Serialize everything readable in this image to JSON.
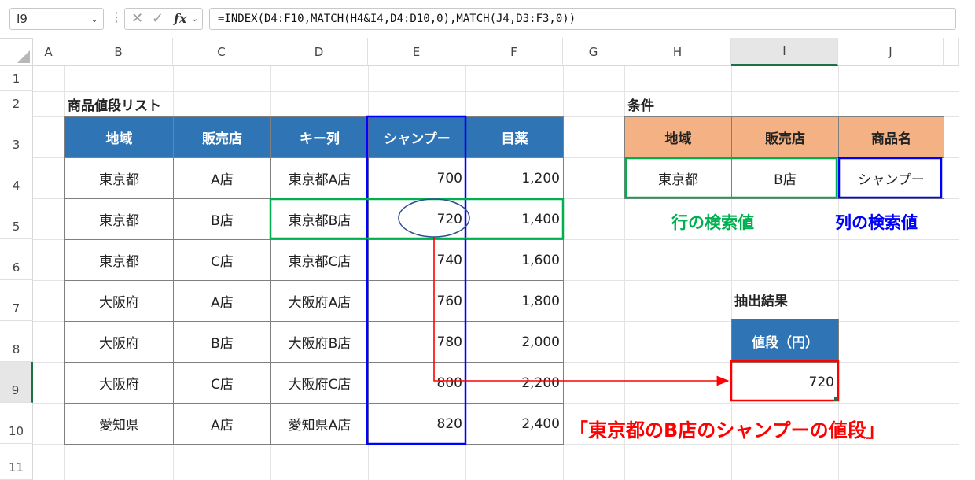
{
  "formula_bar": {
    "name_box": "I9",
    "dots": "⋮",
    "cancel_icon": "✕",
    "enter_icon": "✓",
    "fx": "fx",
    "formula": "=INDEX(D4:F10,MATCH(H4&I4,D4:D10,0),MATCH(J4,D3:F3,0))"
  },
  "columns": [
    "A",
    "B",
    "C",
    "D",
    "E",
    "F",
    "G",
    "H",
    "I",
    "J"
  ],
  "rows": [
    "1",
    "2",
    "3",
    "4",
    "5",
    "6",
    "7",
    "8",
    "9",
    "10",
    "11"
  ],
  "selected_cell": "I9",
  "left_table": {
    "title": "商品値段リスト",
    "headers": [
      "地域",
      "販売店",
      "キー列",
      "シャンプー",
      "目薬"
    ],
    "rows": [
      [
        "東京都",
        "A店",
        "東京都A店",
        "700",
        "1,200"
      ],
      [
        "東京都",
        "B店",
        "東京都B店",
        "720",
        "1,400"
      ],
      [
        "東京都",
        "C店",
        "東京都C店",
        "740",
        "1,600"
      ],
      [
        "大阪府",
        "A店",
        "大阪府A店",
        "760",
        "1,800"
      ],
      [
        "大阪府",
        "B店",
        "大阪府B店",
        "780",
        "2,000"
      ],
      [
        "大阪府",
        "C店",
        "大阪府C店",
        "800",
        "2,200"
      ],
      [
        "愛知県",
        "A店",
        "愛知県A店",
        "820",
        "2,400"
      ]
    ]
  },
  "conditions": {
    "title": "条件",
    "headers": [
      "地域",
      "販売店",
      "商品名"
    ],
    "values": [
      "東京都",
      "B店",
      "シャンプー"
    ]
  },
  "annotations": {
    "row_lookup": "行の検索値",
    "col_lookup": "列の検索値",
    "result_note": "「東京都のB店のシャンプーの値段」"
  },
  "result": {
    "title": "抽出結果",
    "header": "値段（円）",
    "value": "720"
  },
  "colors": {
    "header_blue": "#2f75b5",
    "header_orange": "#f4b183",
    "green_box": "#00b050",
    "blue_box": "#0000ff",
    "red_box": "#ff0000",
    "excel_green": "#1e7145"
  }
}
